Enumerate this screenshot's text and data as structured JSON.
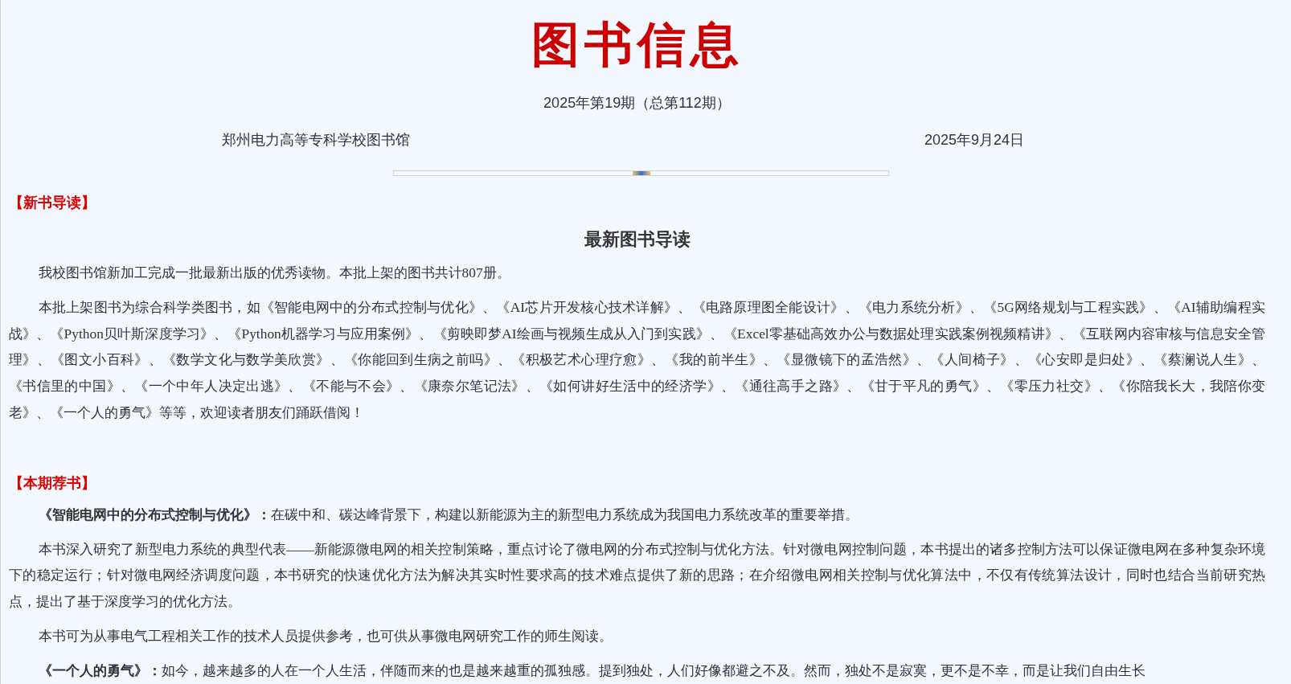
{
  "title": "图书信息",
  "issue": "2025年第19期（总第112期）",
  "publisher": "郑州电力高等专科学校图书馆",
  "date": "2025年9月24日",
  "sections": [
    {
      "heading": "【新书导读】",
      "subtitle": "最新图书导读",
      "paragraphs": [
        "我校图书馆新加工完成一批最新出版的优秀读物。本批上架的图书共计807册。",
        "本批上架图书为综合科学类图书，如《智能电网中的分布式控制与优化》、《AI芯片开发核心技术详解》、《电路原理图全能设计》、《电力系统分析》、《5G网络规划与工程实践》、《AI辅助编程实战》、《Python贝叶斯深度学习》、《Python机器学习与应用案例》、《剪映即梦AI绘画与视频生成从入门到实践》、《Excel零基础高效办公与数据处理实践案例视频精讲》、《互联网内容审核与信息安全管理》、《图文小百科》、《数学文化与数学美欣赏》、《你能回到生病之前吗》、《积极艺术心理疗愈》、《我的前半生》、《显微镜下的孟浩然》、《人间椅子》、《心安即是归处》、《蔡澜说人生》、《书信里的中国》、《一个中年人决定出逃》、《不能与不会》、《康奈尔笔记法》、《如何讲好生活中的经济学》、《通往高手之路》、《甘于平凡的勇气》、《零压力社交》、《你陪我长大，我陪你变老》、《一个人的勇气》等等，欢迎读者朋友们踊跃借阅！"
      ]
    },
    {
      "heading": "【本期荐书】",
      "paragraphs": [
        "**《智能电网中的分布式控制与优化》：**在碳中和、碳达峰背景下，构建以新能源为主的新型电力系统成为我国电力系统改革的重要举措。",
        "本书深入研究了新型电力系统的典型代表——新能源微电网的相关控制策略，重点讨论了微电网的分布式控制与优化方法。针对微电网控制问题，本书提出的诸多控制方法可以保证微电网在多种复杂环境下的稳定运行；针对微电网经济调度问题，本书研究的快速优化方法为解决其实时性要求高的技术难点提供了新的思路；在介绍微电网相关控制与优化算法中，不仅有传统算法设计，同时也结合当前研究热点，提出了基于深度学习的优化方法。",
        "本书可为从事电气工程相关工作的技术人员提供参考，也可供从事微电网研究工作的师生阅读。",
        "**《一个人的勇气》：**如今，越来越多的人在一个人生活，伴随而来的也是越来越重的孤独感。提到独处，人们好像都避之不及。然而，独处不是寂寞，更不是不幸，而是让我们自由生长"
      ]
    }
  ]
}
